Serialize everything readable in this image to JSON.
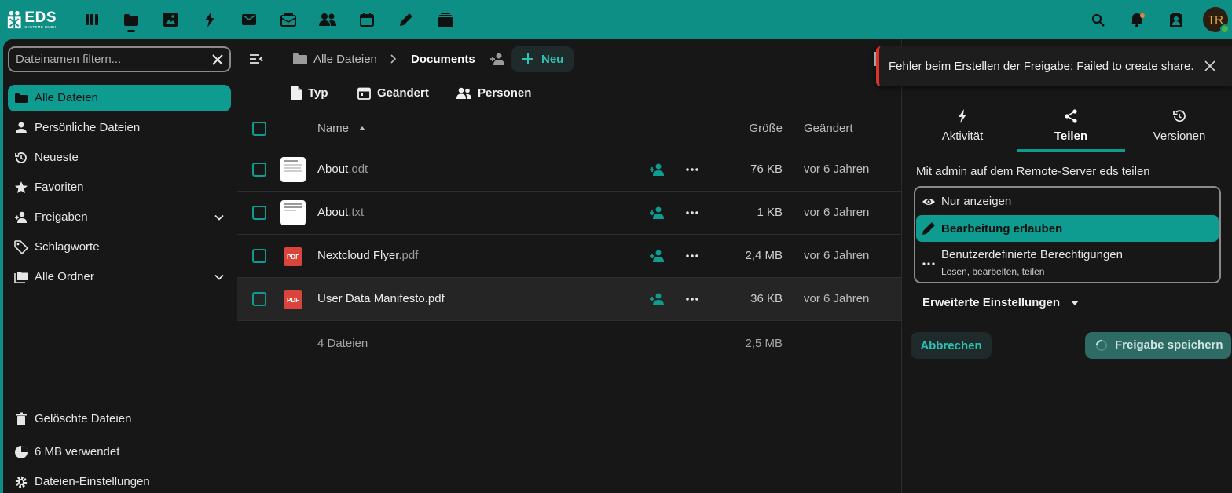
{
  "brand": {
    "logo_text": "EDS",
    "logo_sub": "SYSTEME GMBH"
  },
  "topbar": {
    "apps": [
      "dashboard-icon",
      "files-icon",
      "photos-icon",
      "activity-icon",
      "mail-icon",
      "announcements-icon",
      "contacts-icon",
      "calendar-icon",
      "notes-icon",
      "deck-icon"
    ],
    "active_app": "files-icon",
    "right_icons": [
      "search-icon",
      "notifications-icon",
      "contacts-menu-icon"
    ],
    "avatar_initials": "TR",
    "colors": {
      "header": "#0e8f86",
      "accent": "#0e9b90",
      "notification_dot": "#e9832f",
      "status_online": "#4bb543"
    }
  },
  "sidebar": {
    "filter_placeholder": "Dateinamen filtern...",
    "items": [
      {
        "label": "Alle Dateien",
        "icon": "folder-icon",
        "active": true
      },
      {
        "label": "Persönliche Dateien",
        "icon": "user-icon"
      },
      {
        "label": "Neueste",
        "icon": "history-icon"
      },
      {
        "label": "Favoriten",
        "icon": "star-icon"
      },
      {
        "label": "Freigaben",
        "icon": "share-icon",
        "expandable": true
      },
      {
        "label": "Schlagworte",
        "icon": "tag-icon"
      },
      {
        "label": "Alle Ordner",
        "icon": "folders-icon",
        "expandable": true
      }
    ],
    "footer": [
      {
        "label": "Gelöschte Dateien",
        "icon": "trash-icon"
      },
      {
        "label": "6 MB verwendet",
        "icon": "quota-pie-icon"
      },
      {
        "label": "Dateien-Einstellungen",
        "icon": "gear-icon"
      }
    ]
  },
  "breadcrumb": {
    "root": "Alle Dateien",
    "current": "Documents",
    "new_label": "Neu"
  },
  "filters": [
    "Typ",
    "Geändert",
    "Personen"
  ],
  "table": {
    "columns": {
      "name": "Name",
      "size": "Größe",
      "modified": "Geändert"
    },
    "rows": [
      {
        "base": "About",
        "ext": ".odt",
        "type": "doc",
        "size": "76 KB",
        "modified": "vor 6 Jahren"
      },
      {
        "base": "About",
        "ext": ".txt",
        "type": "doc",
        "size": "1 KB",
        "modified": "vor 6 Jahren"
      },
      {
        "base": "Nextcloud Flyer",
        "ext": ".pdf",
        "type": "pdf",
        "size": "2,4 MB",
        "modified": "vor 6 Jahren"
      },
      {
        "base": "User Data Manifesto",
        "ext": ".pdf",
        "type": "pdf",
        "size": "36 KB",
        "modified": "vor 6 Jahren",
        "highlighted": true
      }
    ],
    "pdf_badge": "PDF",
    "summary": {
      "count": "4 Dateien",
      "size": "2,5 MB"
    }
  },
  "toast": {
    "message": "Fehler beim Erstellen der Freigabe: Failed to create share."
  },
  "sharing": {
    "tabs": [
      {
        "label": "Aktivität",
        "icon": "activity-icon"
      },
      {
        "label": "Teilen",
        "icon": "share-icon",
        "active": true
      },
      {
        "label": "Versionen",
        "icon": "history-icon"
      }
    ],
    "heading": "Mit admin auf dem Remote-Server eds teilen",
    "permissions": [
      {
        "label": "Nur anzeigen",
        "icon": "eye-icon"
      },
      {
        "label": "Bearbeitung erlauben",
        "icon": "pencil-icon",
        "selected": true
      },
      {
        "label": "Benutzerdefinierte Berechtigungen",
        "sub": "Lesen, bearbeiten, teilen",
        "icon": "dots-icon"
      }
    ],
    "advanced_label": "Erweiterte Einstellungen",
    "cancel_label": "Abbrechen",
    "save_label": "Freigabe speichern"
  }
}
